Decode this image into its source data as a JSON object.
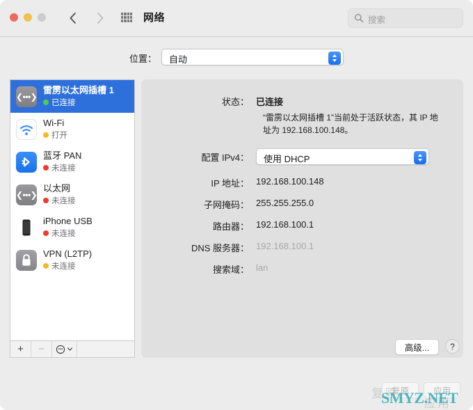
{
  "window": {
    "title": "网络",
    "traffic_lights": [
      "close",
      "minimize",
      "zoom"
    ]
  },
  "toolbar": {
    "back_icon": "chevron-left-icon",
    "forward_icon": "chevron-right-icon",
    "grid_icon": "grid-dots-icon",
    "search": {
      "placeholder": "搜索",
      "value": "",
      "icon": "search-icon"
    }
  },
  "location": {
    "label": "位置：",
    "value": "自动",
    "options": [
      "自动"
    ]
  },
  "sidebar": {
    "items": [
      {
        "name": "雷雳以太网插槽 1",
        "status": "已连接",
        "status_color": "#4cd04c",
        "icon": "ethernet-icon",
        "selected": true
      },
      {
        "name": "Wi-Fi",
        "status": "打开",
        "status_color": "#f5b828",
        "icon": "wifi-icon",
        "selected": false
      },
      {
        "name": "蓝牙 PAN",
        "status": "未连接",
        "status_color": "#ec3b2e",
        "icon": "bluetooth-icon",
        "selected": false
      },
      {
        "name": "以太网",
        "status": "未连接",
        "status_color": "#ec3b2e",
        "icon": "ethernet-icon",
        "selected": false
      },
      {
        "name": "iPhone USB",
        "status": "未连接",
        "status_color": "#ec3b2e",
        "icon": "iphone-icon",
        "selected": false
      },
      {
        "name": "VPN (L2TP)",
        "status": "未连接",
        "status_color": "#f5b828",
        "icon": "lock-icon",
        "selected": false
      }
    ],
    "toolbar": {
      "add_label": "+",
      "remove_label": "−",
      "action_icon": "gear-dots-icon",
      "action_chevron": "chevron-down-icon"
    }
  },
  "details": {
    "status_label": "状态：",
    "status_value": "已连接",
    "description": "“雷雳以太网插槽 1”当前处于活跃状态，其 IP 地址为 192.168.100.148。",
    "ipv4_label": "配置 IPv4：",
    "ipv4_value": "使用 DHCP",
    "ip_label": "IP 地址：",
    "ip_value": "192.168.100.148",
    "subnet_label": "子网掩码：",
    "subnet_value": "255.255.255.0",
    "router_label": "路由器：",
    "router_value": "192.168.100.1",
    "dns_label": "DNS 服务器：",
    "dns_value": "192.168.100.1",
    "searchdomain_label": "搜索域：",
    "searchdomain_value": "lan",
    "advanced_label": "高级...",
    "help_label": "?"
  },
  "footer": {
    "revert_label": "复原",
    "apply_label": "应用"
  },
  "watermark": {
    "text": "SMYZ.NET",
    "ghost_left": "复原",
    "ghost_right": "应用"
  },
  "colors": {
    "accent": "#2d6fdb",
    "window_bg": "#ececec",
    "panel_bg": "#e0e0e0",
    "watermark": "#2ba8b2"
  }
}
